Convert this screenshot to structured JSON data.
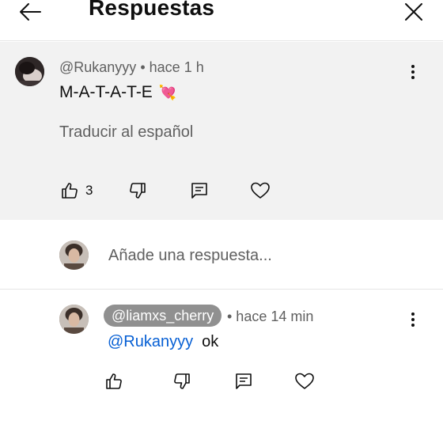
{
  "header": {
    "title": "Respuestas",
    "back_icon": "arrow-left-icon",
    "close_icon": "close-icon"
  },
  "parent_comment": {
    "author": "@Rukanyyy",
    "separator": "•",
    "time": "hace 1 h",
    "text": "M-A-T-A-T-E",
    "emoji": "💘",
    "translate_label": "Traducir al español",
    "likes": "3"
  },
  "reply_box": {
    "placeholder": "Añade una respuesta..."
  },
  "reply": {
    "author": "@liamxs_cherry",
    "time": "• hace 14 min",
    "mention": "@Rukanyyy",
    "text": "ok"
  },
  "colors": {
    "parent_background": "#f2f2f2",
    "mention_link": "#065fd4",
    "secondary_text": "#606060",
    "handle_chip": "#909090"
  }
}
